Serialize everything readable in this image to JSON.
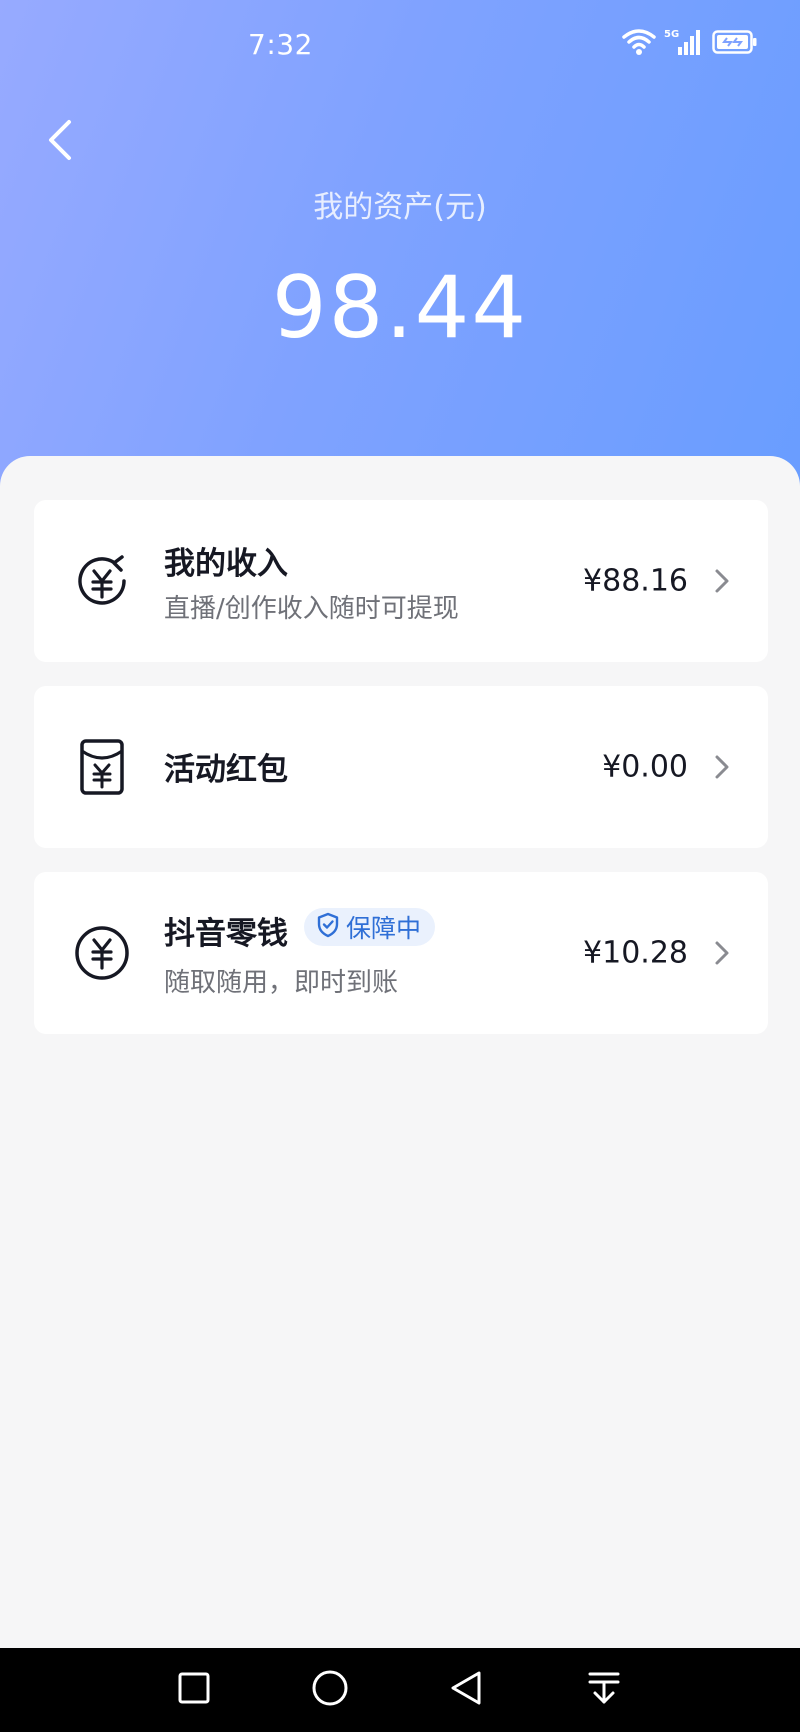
{
  "status_bar": {
    "time": "7:32",
    "icons": [
      "wifi-icon",
      "5g-signal-icon",
      "battery-icon"
    ]
  },
  "header": {
    "asset_label": "我的资产(元)",
    "asset_amount": "98.44"
  },
  "cards": [
    {
      "title": "我的收入",
      "subtitle": "直播/创作收入随时可提现",
      "amount": "¥88.16",
      "icon": "yen-income-icon"
    },
    {
      "title": "活动红包",
      "amount": "¥0.00",
      "icon": "red-packet-icon"
    },
    {
      "title": "抖音零钱",
      "badge": "保障中",
      "subtitle": "随取随用，即时到账",
      "amount": "¥10.28",
      "icon": "yen-coin-icon"
    }
  ],
  "colors": {
    "header_gradient_start": "#97aaff",
    "header_gradient_end": "#699dff",
    "badge_text": "#2f6fd6",
    "badge_bg": "#eaf1fd"
  },
  "nav": [
    "recent-apps-icon",
    "home-icon",
    "back-icon",
    "notification-pull-icon"
  ]
}
